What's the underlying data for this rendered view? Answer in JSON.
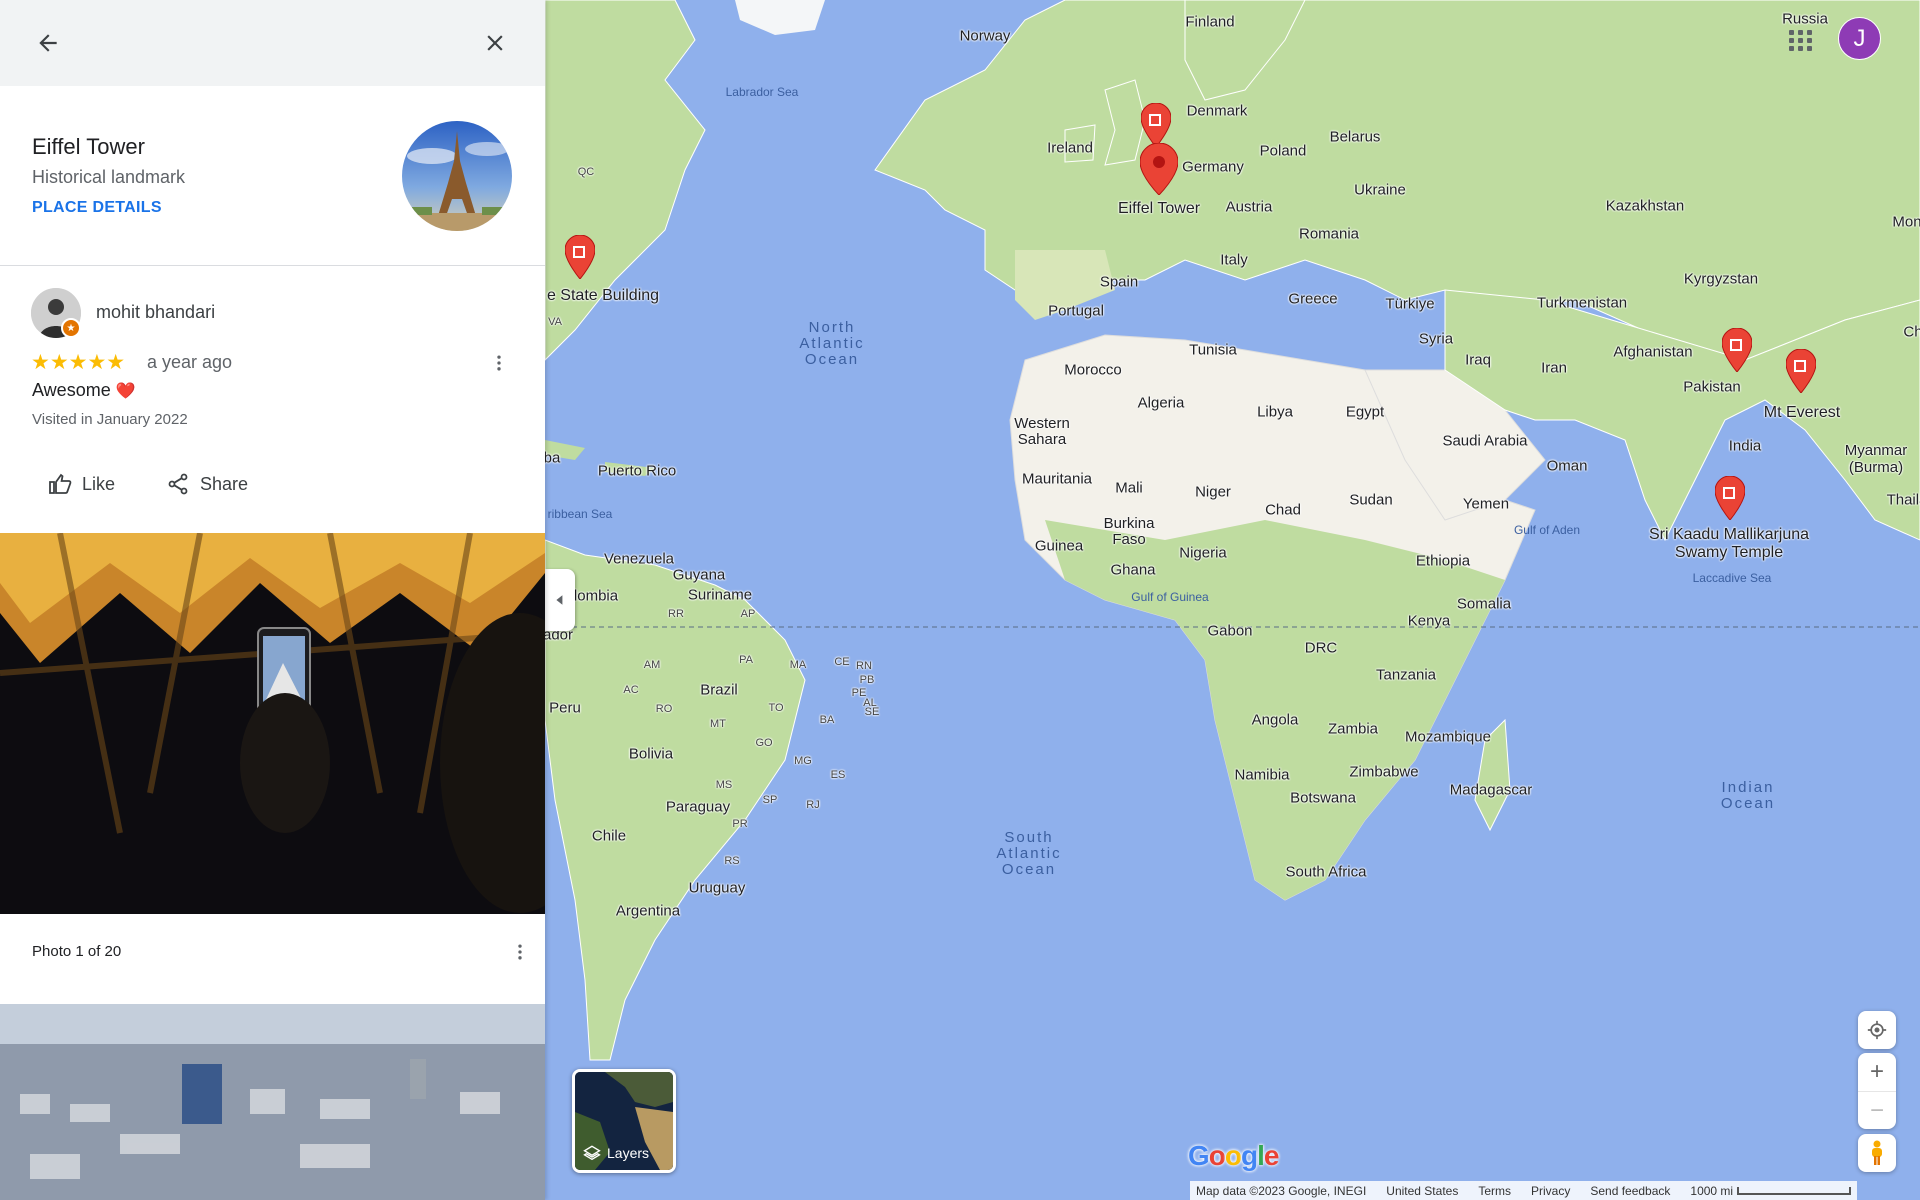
{
  "panel": {
    "back_label": "Back",
    "close_label": "Close",
    "place": {
      "name": "Eiffel Tower",
      "category": "Historical landmark",
      "details_link": "PLACE DETAILS"
    },
    "review": {
      "author": "mohit bhandari",
      "rating": 5,
      "stars": "★★★★★",
      "time_ago": "a year ago",
      "text": "Awesome",
      "emoji": "❤️",
      "visited": "Visited in January 2022",
      "like_label": "Like",
      "share_label": "Share"
    },
    "photo_caption": "Photo 1 of 20"
  },
  "map": {
    "countries": [
      {
        "name": "Norway"
      },
      {
        "name": "Finland"
      },
      {
        "name": "Russia"
      },
      {
        "name": "Denmark"
      },
      {
        "name": "Ireland"
      },
      {
        "name": "Belarus"
      },
      {
        "name": "Poland"
      },
      {
        "name": "Germany"
      },
      {
        "name": "Ukraine"
      },
      {
        "name": "Austria"
      },
      {
        "name": "Kazakhstan"
      },
      {
        "name": "Romania"
      },
      {
        "name": "Italy"
      },
      {
        "name": "Spain"
      },
      {
        "name": "Portugal"
      },
      {
        "name": "Greece"
      },
      {
        "name": "Türkiye"
      },
      {
        "name": "Turkmenistan"
      },
      {
        "name": "Kyrgyzstan"
      },
      {
        "name": "Mon"
      },
      {
        "name": "Syria"
      },
      {
        "name": "Iraq"
      },
      {
        "name": "Iran"
      },
      {
        "name": "Afghanistan"
      },
      {
        "name": "Tunisia"
      },
      {
        "name": "Morocco"
      },
      {
        "name": "Algeria"
      },
      {
        "name": "Libya"
      },
      {
        "name": "Egypt"
      },
      {
        "name": "Pakistan"
      },
      {
        "name": "Western\nSahara"
      },
      {
        "name": "Saudi Arabia"
      },
      {
        "name": "India"
      },
      {
        "name": "Oman"
      },
      {
        "name": "Mauritania"
      },
      {
        "name": "Mali"
      },
      {
        "name": "Niger"
      },
      {
        "name": "Chad"
      },
      {
        "name": "Sudan"
      },
      {
        "name": "Yemen"
      },
      {
        "name": "Myanmar\n(Burma)"
      },
      {
        "name": "Burkina\nFaso"
      },
      {
        "name": "Guinea"
      },
      {
        "name": "Nigeria"
      },
      {
        "name": "Ghana"
      },
      {
        "name": "Ethiopia"
      },
      {
        "name": "Thaila"
      },
      {
        "name": "Somalia"
      },
      {
        "name": "Kenya"
      },
      {
        "name": "Gabon"
      },
      {
        "name": "DRC"
      },
      {
        "name": "Tanzania"
      },
      {
        "name": "Angola"
      },
      {
        "name": "Zambia"
      },
      {
        "name": "Mozambique"
      },
      {
        "name": "Namibia"
      },
      {
        "name": "Zimbabwe"
      },
      {
        "name": "Madagascar"
      },
      {
        "name": "Botswana"
      },
      {
        "name": "South Africa"
      },
      {
        "name": "Venezuela"
      },
      {
        "name": "Guyana"
      },
      {
        "name": "Suriname"
      },
      {
        "name": "lombia"
      },
      {
        "name": "ador"
      },
      {
        "name": "Peru"
      },
      {
        "name": "Brazil"
      },
      {
        "name": "Bolivia"
      },
      {
        "name": "Paraguay"
      },
      {
        "name": "Chile"
      },
      {
        "name": "Uruguay"
      },
      {
        "name": "Argentina"
      },
      {
        "name": "Puerto Rico"
      },
      {
        "name": "ba"
      },
      {
        "name": "Ch"
      }
    ],
    "regions": [
      {
        "name": "QC"
      },
      {
        "name": "VA"
      },
      {
        "name": "RR"
      },
      {
        "name": "AP"
      },
      {
        "name": "AM"
      },
      {
        "name": "MA"
      },
      {
        "name": "CE"
      },
      {
        "name": "RN"
      },
      {
        "name": "PB"
      },
      {
        "name": "PA"
      },
      {
        "name": "PE"
      },
      {
        "name": "AL"
      },
      {
        "name": "TO"
      },
      {
        "name": "RO"
      },
      {
        "name": "MT"
      },
      {
        "name": "BA"
      },
      {
        "name": "GO"
      },
      {
        "name": "MG"
      },
      {
        "name": "MS"
      },
      {
        "name": "ES"
      },
      {
        "name": "SP"
      },
      {
        "name": "RJ"
      },
      {
        "name": "PR"
      },
      {
        "name": "RS"
      },
      {
        "name": "SE"
      },
      {
        "name": "AC"
      }
    ],
    "oceans": [
      {
        "name": "North\nAtlantic\nOcean"
      },
      {
        "name": "South\nAtlantic\nOcean"
      },
      {
        "name": "Indian\nOcean"
      }
    ],
    "seas": [
      {
        "name": "Labrador Sea"
      },
      {
        "name": "ribbean Sea"
      },
      {
        "name": "Gulf of Guinea"
      },
      {
        "name": "Gulf of Aden"
      },
      {
        "name": "Laccadive Sea"
      }
    ],
    "pois": [
      {
        "name": "Eiffel Tower"
      },
      {
        "name": "e State Building"
      },
      {
        "name": "Mt Everest"
      },
      {
        "name": "Sri Kaadu Mallikarjuna\nSwamy Temple"
      }
    ],
    "user_initial": "J",
    "layers_label": "Layers",
    "attribution": {
      "map_data": "Map data ©2023 Google, INEGI",
      "country": "United States",
      "terms": "Terms",
      "privacy": "Privacy",
      "feedback": "Send feedback",
      "scale": "1000 mi"
    },
    "logo": "Google",
    "colors": {
      "water": "#8fb0ec",
      "land_green": "#bfdca0",
      "land_desert": "#f3f1ea",
      "pin_red": "#ea4335",
      "link_blue": "#1a73e8",
      "avatar_purple": "#8e3bb5"
    }
  }
}
